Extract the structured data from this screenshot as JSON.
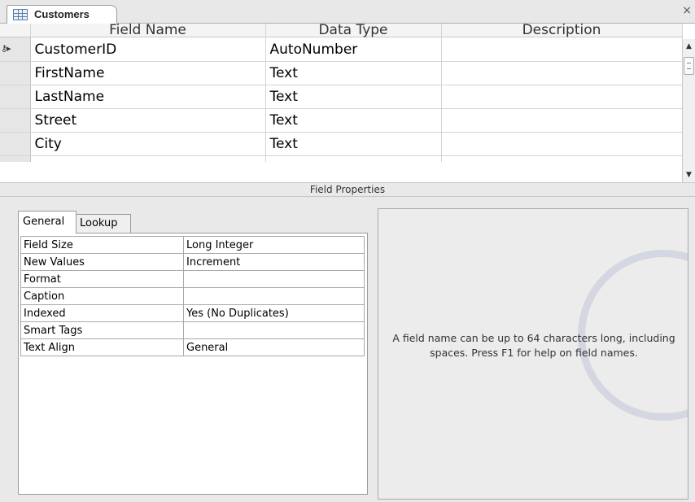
{
  "tab": {
    "title": "Customers",
    "close_glyph": "×",
    "icon": "table-icon"
  },
  "grid": {
    "columns": [
      "Field Name",
      "Data Type",
      "Description"
    ],
    "rows": [
      {
        "field": "CustomerID",
        "type": "AutoNumber",
        "description": "",
        "primary_key": true,
        "selected": true
      },
      {
        "field": "FirstName",
        "type": "Text",
        "description": ""
      },
      {
        "field": "LastName",
        "type": "Text",
        "description": ""
      },
      {
        "field": "Street",
        "type": "Text",
        "description": ""
      },
      {
        "field": "City",
        "type": "Text",
        "description": ""
      }
    ]
  },
  "field_properties": {
    "label": "Field Properties",
    "tabs": [
      "General",
      "Lookup"
    ],
    "active_tab": "General",
    "properties": [
      {
        "name": "Field Size",
        "value": "Long Integer"
      },
      {
        "name": "New Values",
        "value": "Increment"
      },
      {
        "name": "Format",
        "value": ""
      },
      {
        "name": "Caption",
        "value": ""
      },
      {
        "name": "Indexed",
        "value": "Yes (No Duplicates)"
      },
      {
        "name": "Smart Tags",
        "value": ""
      },
      {
        "name": "Text Align",
        "value": "General"
      }
    ],
    "help_text": "A field name can be up to 64 characters long, including spaces. Press F1 for help on field names."
  }
}
